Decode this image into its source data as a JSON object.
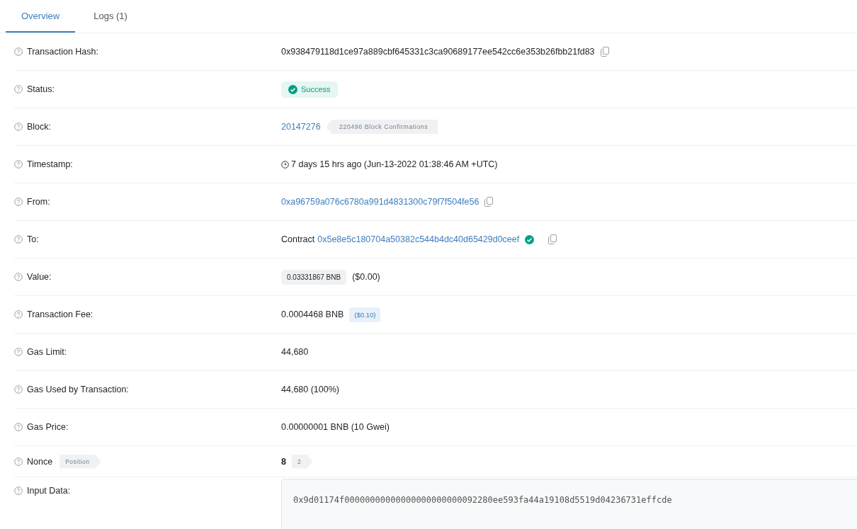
{
  "tabs": [
    {
      "label": "Overview",
      "selected": true
    },
    {
      "label": "Logs (1)",
      "selected": false
    }
  ],
  "rows": [
    {
      "kind": "hash",
      "label": "Transaction Hash:",
      "value": "0x938479118d1ce97a889cbf645331c3ca90689177ee542cc6e353b26fbb21fd83"
    },
    {
      "kind": "status",
      "label": "Status:",
      "value": "Success"
    },
    {
      "kind": "block",
      "label": "Block:",
      "link": "20147276",
      "badge": "220496 Block Confirmations"
    },
    {
      "kind": "timestamp",
      "label": "Timestamp:",
      "value": "7 days 15 hrs ago (Jun-13-2022 01:38:46 AM +UTC)"
    },
    {
      "kind": "address",
      "label": "From:",
      "link": "0xa96759a076c6780a991d4831300c79f7f504fe56"
    },
    {
      "kind": "contract",
      "label": "To:",
      "prefix": "Contract",
      "link": "0x5e8e5c180704a50382c544b4dc40d65429d0ceef"
    },
    {
      "kind": "amount",
      "label": "Value:",
      "amount": "0.03331867 BNB",
      "value": "($0.00)"
    },
    {
      "kind": "fee",
      "label": "Transaction Fee:",
      "value": "0.0004468 BNB",
      "badge": "($0.10)"
    },
    {
      "kind": "text",
      "label": "Gas Limit:",
      "value": "44,680"
    },
    {
      "kind": "text",
      "label": "Gas Used by Transaction:",
      "value": "44,680 (100%)"
    },
    {
      "kind": "text",
      "label": "Gas Price:",
      "value": "0.00000001 BNB (10 Gwei)"
    },
    {
      "kind": "nonce",
      "label": "Nonce",
      "label_badge": "Position",
      "value": "8",
      "badge": "2"
    },
    {
      "kind": "input",
      "label": "Input Data:",
      "value": "0x9d01174f00000000000000000000000092280ee593fa44a19108d5519d04236731effcde"
    }
  ]
}
